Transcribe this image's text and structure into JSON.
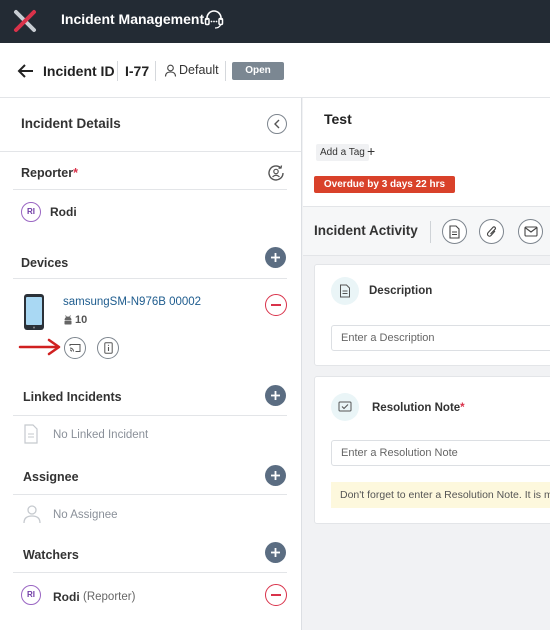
{
  "app": {
    "title": "Incident Management",
    "logo_icon": "x-logo",
    "accent": "#d9324a"
  },
  "header": {
    "back_icon": "arrow-left-icon",
    "title": "Incident ID",
    "incident_id": "I-77",
    "profile": "Default",
    "status": "Open"
  },
  "left_panel": {
    "title": "Incident Details",
    "reporter": {
      "label": "Reporter",
      "required_mark": "*",
      "initials": "RI",
      "name": "Rodi"
    },
    "devices": {
      "label": "Devices",
      "items": [
        {
          "name": "samsungSM-N976B 00002",
          "os_version": "10"
        }
      ]
    },
    "linked_incidents": {
      "label": "Linked Incidents",
      "empty": "No Linked Incident"
    },
    "assignee": {
      "label": "Assignee",
      "empty": "No Assignee"
    },
    "watchers": {
      "label": "Watchers",
      "items": [
        {
          "initials": "RI",
          "name": "Rodi",
          "role": "(Reporter)"
        }
      ]
    }
  },
  "main": {
    "incident_name": "Test",
    "add_tag": "Add a Tag",
    "overdue": "Overdue by 3 days 22 hrs",
    "activity_title": "Incident Activity",
    "description": {
      "label": "Description",
      "placeholder": "Enter a Description"
    },
    "resolution": {
      "label": "Resolution Note",
      "required_mark": "*",
      "placeholder": "Enter a Resolution Note",
      "warning": "Don't forget to enter a Resolution Note. It is m"
    }
  }
}
